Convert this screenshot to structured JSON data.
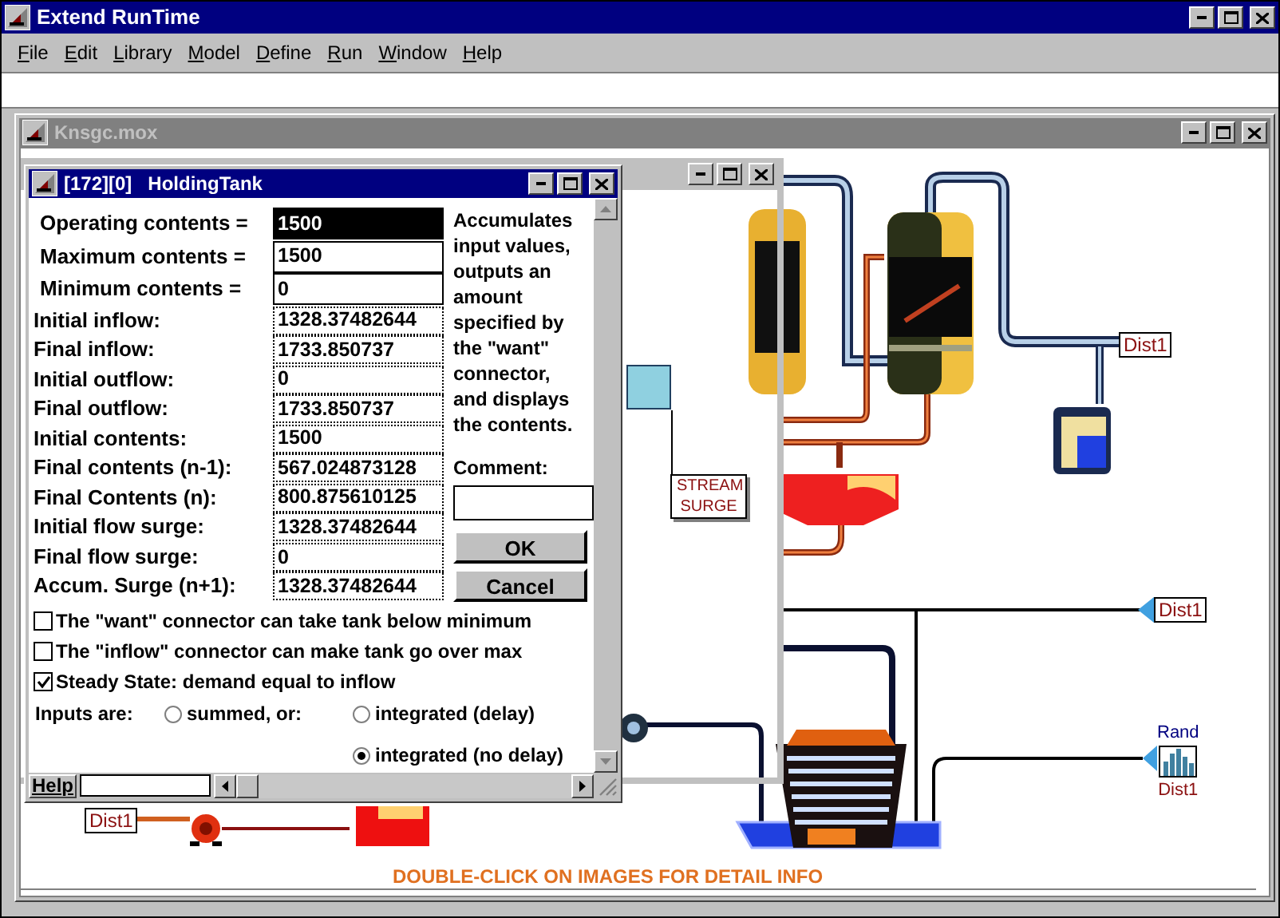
{
  "app": {
    "title": "Extend RunTime",
    "menu": [
      "File",
      "Edit",
      "Library",
      "Model",
      "Define",
      "Run",
      "Window",
      "Help"
    ]
  },
  "model_window": {
    "title": "Knsgc.mox"
  },
  "canvas": {
    "blocks": [
      {
        "kind": "dist",
        "label": "Dist1"
      },
      {
        "kind": "note",
        "label": "STREAM SURGE"
      },
      {
        "kind": "dist",
        "label": "Dist1"
      },
      {
        "kind": "random",
        "label": "Rand",
        "sublabel": "Dist1"
      },
      {
        "kind": "dist",
        "label": "Dist1"
      }
    ],
    "instruction": "DOUBLE-CLICK ON IMAGES FOR DETAIL INFO"
  },
  "dialog": {
    "title": "[172][0]   HoldingTank",
    "fields": [
      {
        "kind": "input",
        "label": "Operating contents =",
        "value": "1500",
        "selected": true
      },
      {
        "kind": "input",
        "label": "Maximum contents =",
        "value": "1500",
        "selected": false
      },
      {
        "kind": "input",
        "label": "Minimum contents =",
        "value": "0",
        "selected": false
      },
      {
        "kind": "readout",
        "label": "Initial inflow:",
        "value": "1328.37482644",
        "selected": false
      },
      {
        "kind": "readout",
        "label": "Final inflow:",
        "value": "1733.850737",
        "selected": false
      },
      {
        "kind": "readout",
        "label": "Initial outflow:",
        "value": "0",
        "selected": false
      },
      {
        "kind": "readout",
        "label": "Final outflow:",
        "value": "1733.850737",
        "selected": false
      },
      {
        "kind": "readout",
        "label": "Initial contents:",
        "value": "1500",
        "selected": false
      },
      {
        "kind": "readout",
        "label": "Final contents (n-1):",
        "value": "567.024873128",
        "selected": false
      },
      {
        "kind": "readout",
        "label": "Final Contents (n):",
        "value": "800.875610125",
        "selected": false
      },
      {
        "kind": "readout",
        "label": "Initial flow surge:",
        "value": "1328.37482644",
        "selected": false
      },
      {
        "kind": "readout",
        "label": "Final flow surge:",
        "value": "0",
        "selected": false
      },
      {
        "kind": "readout",
        "label": "Accum. Surge (n+1):",
        "value": "1328.37482644",
        "selected": false
      }
    ],
    "description": "Accumulates input values, outputs an amount specified by the \"want\" connector, and displays the contents.",
    "comment_label": "Comment:",
    "buttons": [
      "OK",
      "Cancel"
    ],
    "options": [
      {
        "label": "The \"want\" connector can take tank below minimum",
        "checked": false
      },
      {
        "label": "The \"inflow\" connector can make tank go over max",
        "checked": false
      },
      {
        "label": "Steady State: demand equal to inflow",
        "checked": true
      }
    ],
    "inputs_label": "Inputs are:",
    "input_modes": [
      {
        "label": "summed, or:",
        "selected": false
      },
      {
        "label": "integrated (delay)",
        "selected": false
      },
      {
        "label": "integrated (no delay)",
        "selected": true
      }
    ],
    "help_button": "Help"
  }
}
